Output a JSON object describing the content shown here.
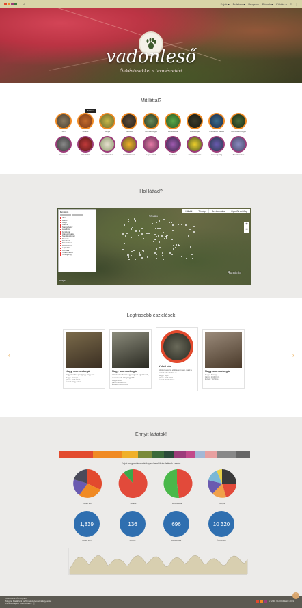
{
  "topbar": {
    "logo_colors": [
      "#e24a2e",
      "#f08a23",
      "#9c3c7a",
      "#3e7a3e"
    ],
    "nav": [
      "Fajok ▾",
      "Érdekes ▾",
      "Program",
      "Rólunk ▾",
      "Küldés ▾",
      "≡",
      "⋮"
    ]
  },
  "hero": {
    "title": "vadonleső",
    "subtitle": "Önkéntesekkel a természetért"
  },
  "sighting_types": {
    "title": "Mit láttál?",
    "row1": [
      "Sün",
      "Mókus",
      "Gólya",
      "Vakond",
      "Szarvasbogár",
      "Levelibéka",
      "Kőrisbogár",
      "Imádkozó sáska",
      "Szentjánosbogár"
    ],
    "row2": [
      "Denevér",
      "Rókafélék",
      "Tündérrózsa",
      "Pókhálófélék",
      "Lepkefélék",
      "Orchidea",
      "Tavaszi hérics",
      "Harangvirág",
      "Tündérrózsa"
    ],
    "tooltip": "Mókus"
  },
  "map_section": {
    "title": "Hol láttad?",
    "map_types": [
      "Hibrid",
      "Térkép",
      "Szintvonalas",
      "OpenStreetMap"
    ],
    "legend_title": "Faj szűrés",
    "legend_items": [
      "Sün",
      "Mókus",
      "Gólya",
      "Vakond",
      "Szarvasbogár",
      "Levelibéka",
      "Kőrisbogár",
      "Imádkozó sáska",
      "Szentjánosbogár",
      "Denevér",
      "Rókafélék",
      "Tündérrózsa",
      "Pókhálófélék",
      "Lepkefélék",
      "Orchidea",
      "Tavaszi hérics",
      "Harangvirág"
    ],
    "place_labels": [
      "Szlovákia",
      "Románia",
      "Budapest"
    ],
    "google": "Google"
  },
  "latest": {
    "title": "Legfrissebb észlelések",
    "cards": [
      {
        "title": "Nagy szarvasbogár",
        "desc": "Hagyott néhol pedig egy nagy volt...",
        "meta": [
          "Megye: Baranya",
          "Dátum: 2019.07.02",
          "Észlelő: Nagy Gábor"
        ]
      },
      {
        "title": "Nagy szarvasbogár",
        "desc": "A házunk udvarán egy nagy és egy kis volt, a miénk volt a legnagyobb.",
        "meta": [
          "Megye: Pest",
          "Dátum: 2019.07.02",
          "Észlelő: Kovács Anna"
        ]
      },
      {
        "title": "Keleti sün",
        "desc": "Az úton a kocsi előtt jelent meg, majd a bokrok felé szaladt el.",
        "meta": [
          "Megye: Fejér",
          "Dátum: 2019.07.01",
          "Észlelő: Szabó Péter"
        ]
      },
      {
        "title": "Nagy szarvasbogár",
        "desc": "",
        "meta": [
          "Megye: Somogy",
          "Dátum: 2019.07.01",
          "Észlelő: Tóth Éva"
        ]
      }
    ]
  },
  "stats": {
    "title": "Ennyit láttatok!",
    "pies_title": "Fajok megoszlása a térképen bejelölt észlelések szerint",
    "pie_labels": [
      "Keleti sün",
      "Mókus",
      "Levelibéka",
      "Gólya"
    ],
    "bubbles": [
      {
        "value": "1,839",
        "label": "Keleti sün"
      },
      {
        "value": "136",
        "label": "Mókus"
      },
      {
        "value": "696",
        "label": "Levelibéka"
      },
      {
        "value": "10 320",
        "label": "Összesen"
      }
    ],
    "bar_colors": [
      "#e24a2e",
      "#f08a23",
      "#f0b02a",
      "#7a8a3a",
      "#3a6a3a",
      "#2a4a3a",
      "#9c3c7a",
      "#c24a8a",
      "#a3b8d6",
      "#e8a0a0",
      "#888",
      "#666"
    ]
  },
  "footer": {
    "lines": [
      "VADONLESŐ Program",
      "Magyar Madártani és Természetvédelmi Egyesület",
      "1121 Budapest Költő utca 21. ⓘ"
    ],
    "right": "© MME VADONLESŐ 2019"
  }
}
